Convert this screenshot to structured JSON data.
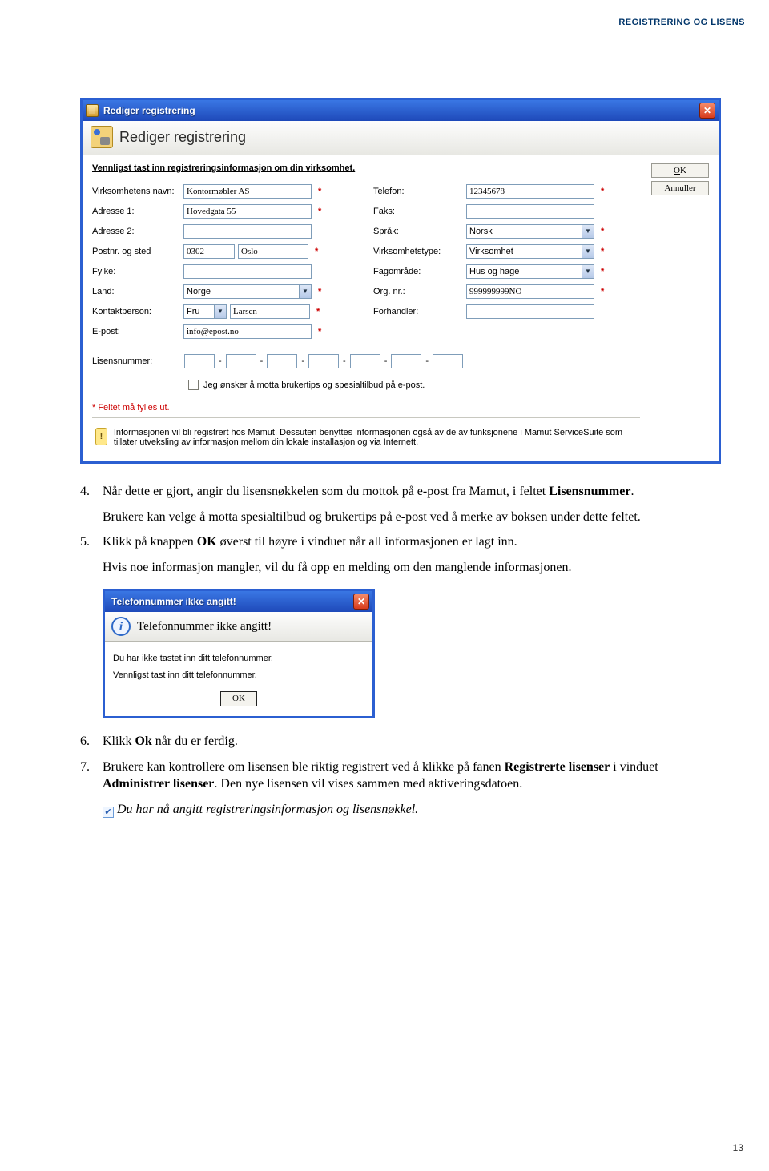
{
  "header": {
    "section_title": "REGISTRERING OG LISENS"
  },
  "page_number": "13",
  "dialog1": {
    "window_title": "Rediger registrering",
    "header_title": "Rediger registrering",
    "instruction": "Vennligst tast inn registreringsinformasjon om din virksomhet.",
    "buttons": {
      "ok": "OK",
      "cancel": "Annuller"
    },
    "left": {
      "company_label": "Virksomhetens navn:",
      "company_value": "Kontormøbler AS",
      "addr1_label": "Adresse 1:",
      "addr1_value": "Hovedgata 55",
      "addr2_label": "Adresse 2:",
      "addr2_value": "",
      "post_label": "Postnr. og sted",
      "post_code": "0302",
      "post_city": "Oslo",
      "fylke_label": "Fylke:",
      "fylke_value": "",
      "land_label": "Land:",
      "land_value": "Norge",
      "contact_label": "Kontaktperson:",
      "contact_title": "Fru",
      "contact_name": "Larsen",
      "email_label": "E-post:",
      "email_value": "info@epost.no"
    },
    "right": {
      "tel_label": "Telefon:",
      "tel_value": "12345678",
      "fax_label": "Faks:",
      "fax_value": "",
      "lang_label": "Språk:",
      "lang_value": "Norsk",
      "type_label": "Virksomhetstype:",
      "type_value": "Virksomhet",
      "fag_label": "Fagområde:",
      "fag_value": "Hus og hage",
      "org_label": "Org. nr.:",
      "org_value": "999999999NO",
      "forh_label": "Forhandler:",
      "forh_value": ""
    },
    "license_label": "Lisensnummer:",
    "checkbox_label": "Jeg ønsker å motta brukertips og spesialtilbud på e-post.",
    "required_note": "* Feltet må fylles ut.",
    "info_text": "Informasjonen vil bli registrert hos Mamut. Dessuten benyttes informasjonen også av de av funksjonene i Mamut ServiceSuite som tillater utveksling av informasjon mellom din lokale installasjon og via Internett."
  },
  "doc": {
    "p4_a": "Når dette er gjort, angir du lisensnøkkelen som du mottok på e-post fra Mamut, i feltet ",
    "p4_b": "Lisensnummer",
    "p4_c": ".",
    "p4_sub": "Brukere kan velge å motta spesialtilbud og brukertips på e-post ved å merke av boksen under dette feltet.",
    "p5_a": "Klikk på knappen ",
    "p5_b": "OK",
    "p5_c": " øverst til høyre i vinduet når all informasjonen er lagt inn.",
    "p5_sub": "Hvis noe informasjon mangler, vil du få opp en melding om den manglende informasjonen.",
    "p6_a": "Klikk ",
    "p6_b": "Ok",
    "p6_c": " når du er ferdig.",
    "p7_a": "Brukere kan kontrollere om lisensen ble riktig registrert ved å klikke på fanen ",
    "p7_b": "Registrerte lisenser",
    "p7_c": " i vinduet ",
    "p7_d": "Administrer lisenser",
    "p7_e": ". Den nye lisensen vil vises sammen med aktiveringsdatoen.",
    "done": "Du har nå angitt registreringsinformasjon og lisensnøkkel."
  },
  "dialog2": {
    "window_title": "Telefonnummer ikke angitt!",
    "header_title": "Telefonnummer ikke angitt!",
    "line1": "Du har ikke tastet inn ditt telefonnummer.",
    "line2": "Vennligst tast inn ditt telefonnummer.",
    "ok": "OK"
  }
}
